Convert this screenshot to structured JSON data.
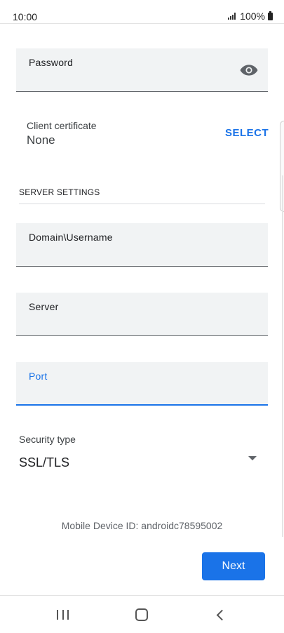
{
  "status_bar": {
    "time": "10:00",
    "battery": "100%"
  },
  "fields": {
    "password": {
      "label": "Password"
    },
    "domain_username": {
      "label": "Domain\\Username"
    },
    "server": {
      "label": "Server"
    },
    "port": {
      "label": "Port"
    }
  },
  "client_certificate": {
    "label": "Client certificate",
    "value": "None",
    "select_label": "SELECT"
  },
  "server_settings": {
    "header": "SERVER SETTINGS"
  },
  "security_type": {
    "label": "Security type",
    "value": "SSL/TLS"
  },
  "device_id": "Mobile Device ID: androidc78595002",
  "next_label": "Next",
  "colors": {
    "accent": "#1a73e8",
    "field_bg": "#f1f3f4"
  },
  "icons": {
    "password_toggle": "eye-icon",
    "dropdown": "dropdown-arrow-icon"
  }
}
